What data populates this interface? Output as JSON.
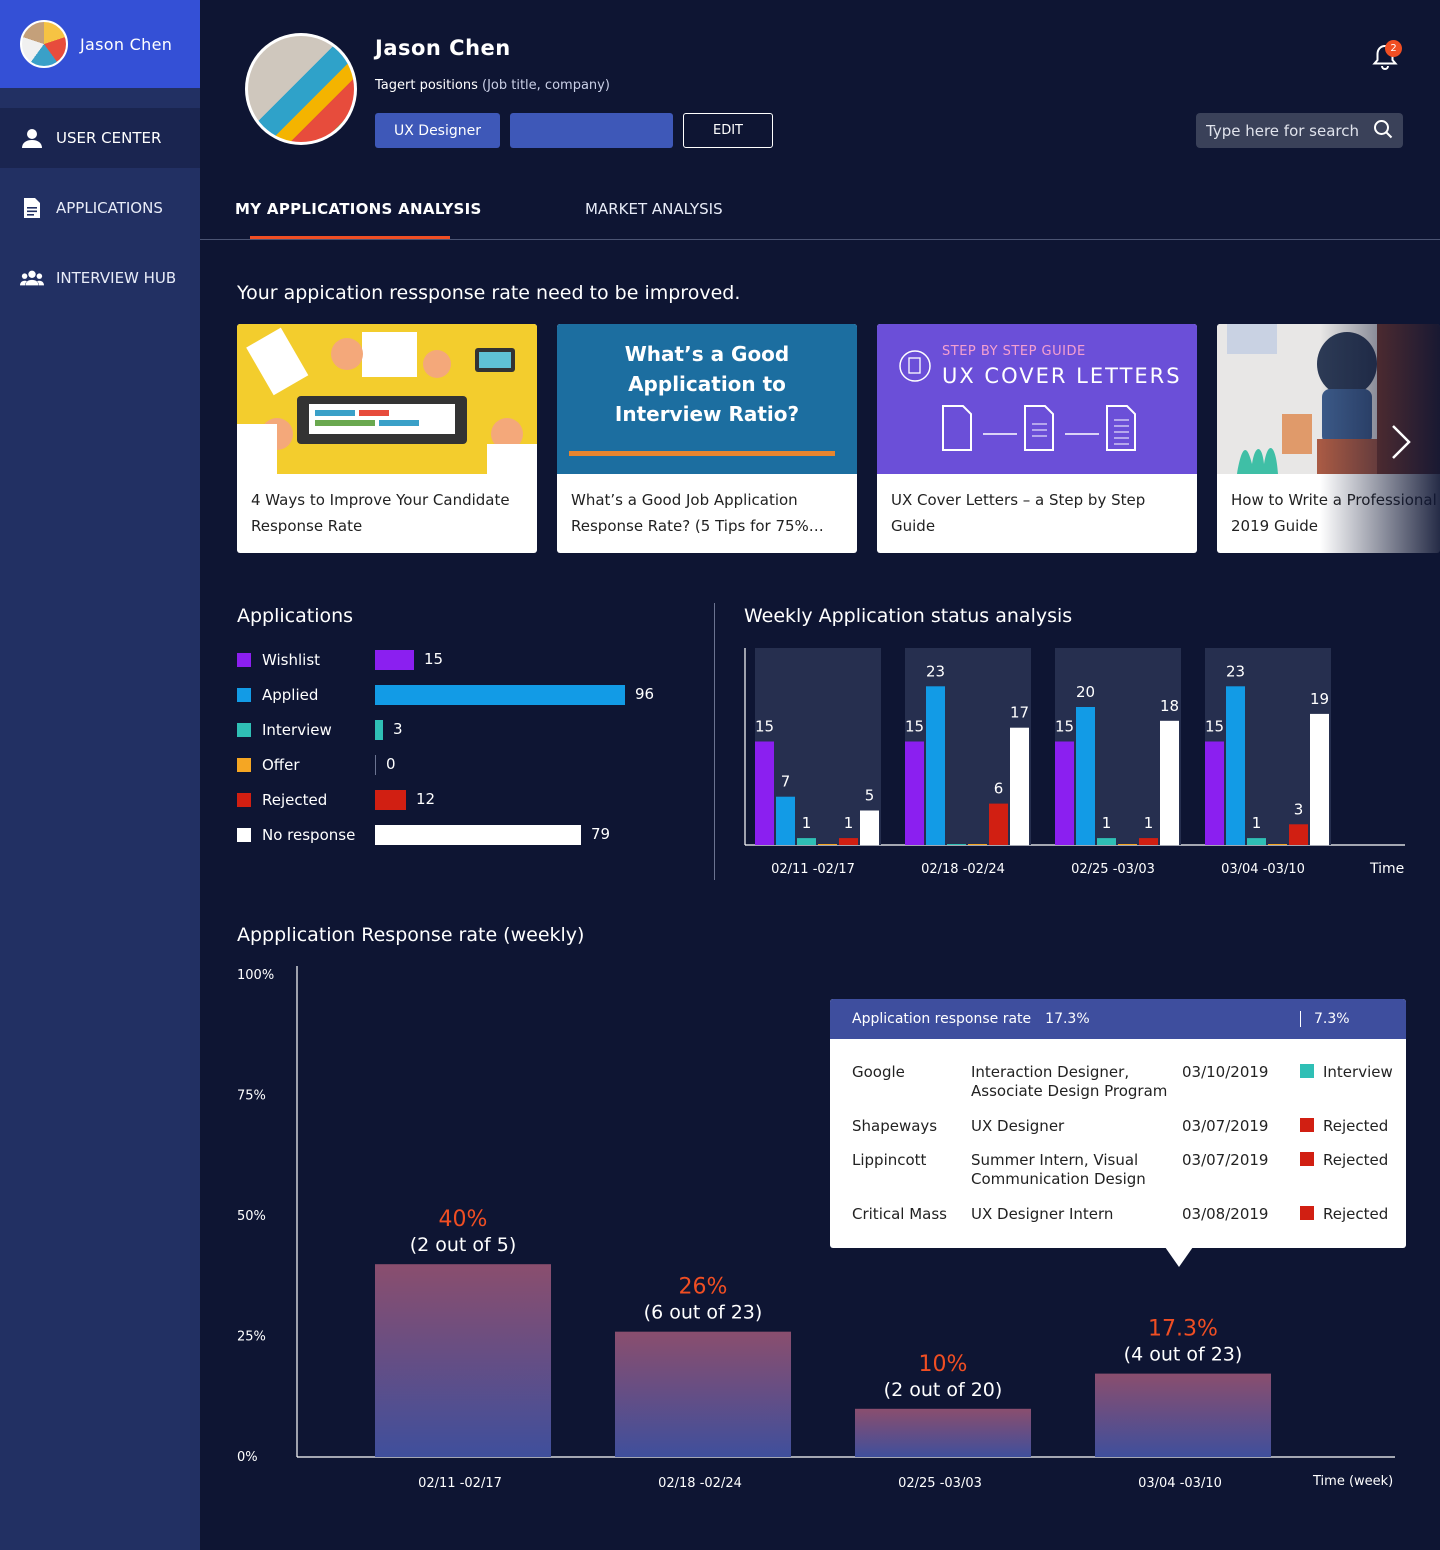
{
  "sidebar": {
    "user_name": "Jason Chen",
    "items": [
      {
        "label": "USER CENTER",
        "icon": "user-icon",
        "active": true
      },
      {
        "label": "APPLICATIONS",
        "icon": "document-icon",
        "active": false
      },
      {
        "label": "INTERVIEW HUB",
        "icon": "group-icon",
        "active": false
      }
    ]
  },
  "header": {
    "name": "Jason Chen",
    "target_label": "Tagert positions",
    "target_hint": "(Job title, company)",
    "pill_1": "UX Designer",
    "pill_2": "",
    "edit_label": "EDIT",
    "notification_count": "2",
    "search_placeholder": "Type here for search"
  },
  "tabs": [
    {
      "label": "MY APPLICATIONS ANALYSIS",
      "active": true
    },
    {
      "label": "MARKET ANALYSIS",
      "active": false
    }
  ],
  "notice": "Your appication ressponse rate need to be improved.",
  "articles": [
    {
      "title_1": "4 Ways to Improve Your Candidate",
      "title_2": "Response Rate"
    },
    {
      "thumb_text_1": "What’s a Good",
      "thumb_text_2": "Application to",
      "thumb_text_3": "Interview Ratio?",
      "title_1": "What’s a Good Job Application",
      "title_2": "Response Rate? (5 Tips for 75%…"
    },
    {
      "thumb_kicker": "STEP BY STEP GUIDE",
      "thumb_head": "UX COVER LETTERS",
      "title_1": "UX Cover Letters – a Step by Step Guide",
      "title_2": ""
    },
    {
      "title_1": "How to Write a Professional",
      "title_2": "2019 Guide"
    }
  ],
  "applications": {
    "title": "Applications",
    "colors": {
      "Wishlist": "#8b1ff0",
      "Applied": "#129be6",
      "Interview": "#2fbfb5",
      "Offer": "#f5a623",
      "Rejected": "#d11f12",
      "No response": "#ffffff"
    },
    "rows": [
      {
        "label": "Wishlist",
        "value": 15
      },
      {
        "label": "Applied",
        "value": 96
      },
      {
        "label": "Interview",
        "value": 3
      },
      {
        "label": "Offer",
        "value": 0
      },
      {
        "label": "Rejected",
        "value": 12
      },
      {
        "label": "No response",
        "value": 79
      }
    ]
  },
  "weekly_chart_title": "Weekly Application status analysis",
  "response_chart_title": "Appplication Response rate (weekly)",
  "chart_data": [
    {
      "type": "bar",
      "title": "Weekly Application status analysis",
      "xlabel": "Time",
      "categories": [
        "02/11 -02/17",
        "02/18 -02/24",
        "02/25 -03/03",
        "03/04 -03/10"
      ],
      "series": [
        {
          "name": "Wishlist",
          "values": [
            15,
            15,
            15,
            15
          ]
        },
        {
          "name": "Applied",
          "values": [
            7,
            23,
            20,
            23
          ]
        },
        {
          "name": "Interview",
          "values": [
            1,
            0,
            1,
            1
          ]
        },
        {
          "name": "Offer",
          "values": [
            0,
            0,
            0,
            0
          ]
        },
        {
          "name": "Rejected",
          "values": [
            1,
            6,
            1,
            3
          ]
        },
        {
          "name": "No response",
          "values": [
            5,
            17,
            18,
            19
          ]
        }
      ],
      "ylim": [
        0,
        30
      ]
    },
    {
      "type": "bar",
      "title": "Appplication Response rate (weekly)",
      "xlabel": "Time (week)",
      "yticks": [
        "0%",
        "25%",
        "50%",
        "75%",
        "100%"
      ],
      "ylim": [
        0,
        100
      ],
      "categories": [
        "02/11 -02/17",
        "02/18 -02/24",
        "02/25 -03/03",
        "03/04 -03/10"
      ],
      "values": [
        40,
        26,
        10,
        17.3
      ],
      "value_labels": [
        "40%",
        "26%",
        "10%",
        "17.3%"
      ],
      "sub_labels": [
        "(2 out of 5)",
        "(6 out of 23)",
        "(2 out of 20)",
        "(4 out of 23)"
      ]
    }
  ],
  "tooltip": {
    "label": "Application response rate",
    "value": "17.3%",
    "right_value": "7.3%",
    "rows": [
      {
        "company": "Google",
        "role_1": "Interaction Designer,",
        "role_2": "Associate Design Program",
        "date": "03/10/2019",
        "status": "Interview",
        "color": "#2fbfb5"
      },
      {
        "company": "Shapeways",
        "role_1": "UX Designer",
        "role_2": "",
        "date": "03/07/2019",
        "status": "Rejected",
        "color": "#d11f12"
      },
      {
        "company": "Lippincott",
        "role_1": "Summer Intern, Visual",
        "role_2": "Communication Design",
        "date": "03/07/2019",
        "status": "Rejected",
        "color": "#d11f12"
      },
      {
        "company": "Critical Mass",
        "role_1": "UX Designer Intern",
        "role_2": "",
        "date": "03/08/2019",
        "status": "Rejected",
        "color": "#d11f12"
      }
    ]
  }
}
